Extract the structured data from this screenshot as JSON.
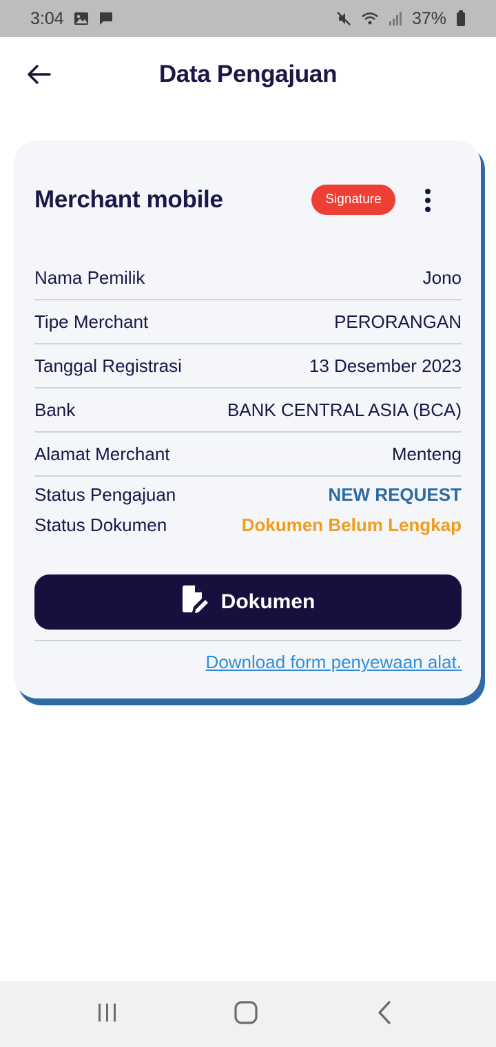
{
  "status_bar": {
    "time": "3:04",
    "battery": "37%",
    "icons": [
      "image-icon",
      "message-icon",
      "mute-icon",
      "wifi-icon",
      "signal-icon",
      "battery-icon"
    ]
  },
  "header": {
    "title": "Data Pengajuan",
    "back_icon": "arrow-left-icon"
  },
  "card": {
    "merchant_name": "Merchant mobile",
    "badge": "Signature",
    "rows": [
      {
        "label": "Nama Pemilik",
        "value": "Jono"
      },
      {
        "label": "Tipe Merchant",
        "value": "PERORANGAN"
      },
      {
        "label": "Tanggal Registrasi",
        "value": "13 Desember 2023"
      },
      {
        "label": "Bank",
        "value": "BANK CENTRAL ASIA (BCA)"
      },
      {
        "label": "Alamat Merchant",
        "value": "Menteng"
      }
    ],
    "status_pengajuan": {
      "label": "Status Pengajuan",
      "value": "NEW REQUEST"
    },
    "status_dokumen": {
      "label": "Status Dokumen",
      "value": "Dokumen Belum Lengkap"
    },
    "button_label": "Dokumen",
    "download_link": "Download form penyewaan alat."
  },
  "colors": {
    "primary": "#17103f",
    "badge": "#ee3f35",
    "request": "#2c6aa0",
    "warning": "#f29c1f",
    "link": "#2e8fd8"
  }
}
